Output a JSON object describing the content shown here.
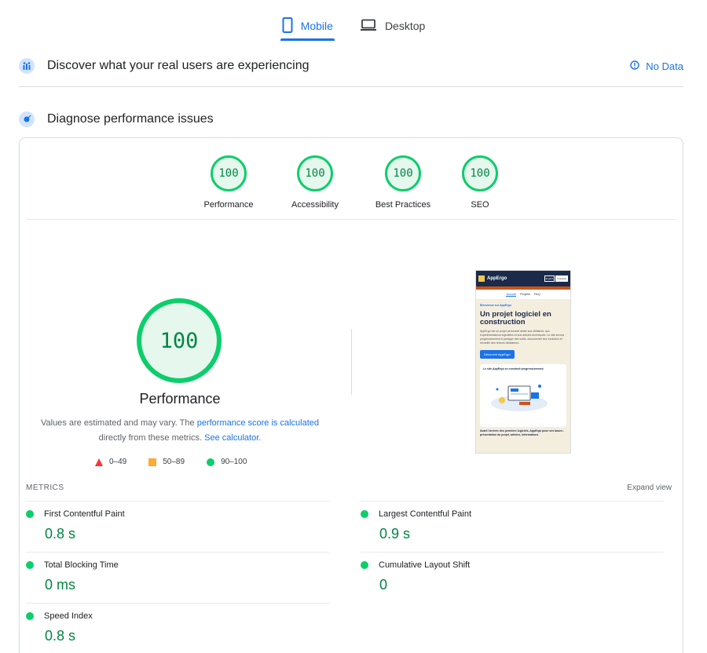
{
  "tabs": [
    {
      "label": "Mobile",
      "icon": "mobile-phone-icon",
      "active": true
    },
    {
      "label": "Desktop",
      "icon": "laptop-icon",
      "active": false
    }
  ],
  "field_section": {
    "title": "Discover what your real users are experiencing",
    "icon": "field-data-icon",
    "status": "No Data",
    "status_icon": "info-icon"
  },
  "lab_section": {
    "title": "Diagnose performance issues",
    "icon": "lab-data-icon"
  },
  "gauges": [
    {
      "score": "100",
      "label": "Performance"
    },
    {
      "score": "100",
      "label": "Accessibility"
    },
    {
      "score": "100",
      "label": "Best Practices"
    },
    {
      "score": "100",
      "label": "SEO"
    }
  ],
  "performance": {
    "score": "100",
    "title": "Performance",
    "note_prefix": "Values are estimated and may vary. The ",
    "note_link": "performance score is calculated",
    "note_middle": " directly from these metrics. ",
    "calc_link": "See calculator.",
    "legend": [
      {
        "shape": "triangle",
        "color": "#ff3333",
        "range": "0–49"
      },
      {
        "shape": "square",
        "color": "#ffaa33",
        "range": "50–89"
      },
      {
        "shape": "circle",
        "color": "#0cce6b",
        "range": "90–100"
      }
    ]
  },
  "screenshot": {
    "brand": "AppErgo",
    "lang_en": "English",
    "lang_fr": "Français",
    "nav": [
      "Accueil",
      "Projets",
      "FAQ"
    ],
    "kicker": "Bienvenue sur AppErgo",
    "headline": "Un projet logiciel en construction",
    "paragraph": "AppErgo est un projet personnel dédié aux utilitaires, aux expérimentations logicielles et aux articles techniques. Le site servira progressivement à partager des outils, documenter leur évolution et recueillir des retours utilisateurs.",
    "button": "Découvrir AppErgo",
    "card_title": "Le site AppErgo se construit progressivement",
    "footer": "Avant l'arrivée des premiers logiciels, AppErgo pose ses bases : présentation du projet, articles, informations"
  },
  "metrics": {
    "header": "METRICS",
    "expand": "Expand view",
    "items": [
      {
        "name": "First Contentful Paint",
        "value": "0.8 s"
      },
      {
        "name": "Largest Contentful Paint",
        "value": "0.9 s"
      },
      {
        "name": "Total Blocking Time",
        "value": "0 ms"
      },
      {
        "name": "Cumulative Layout Shift",
        "value": "0"
      },
      {
        "name": "Speed Index",
        "value": "0.8 s"
      }
    ]
  },
  "colors": {
    "accent": "#1a73e8",
    "pass": "#0cce6b",
    "pass_text": "#018642"
  }
}
